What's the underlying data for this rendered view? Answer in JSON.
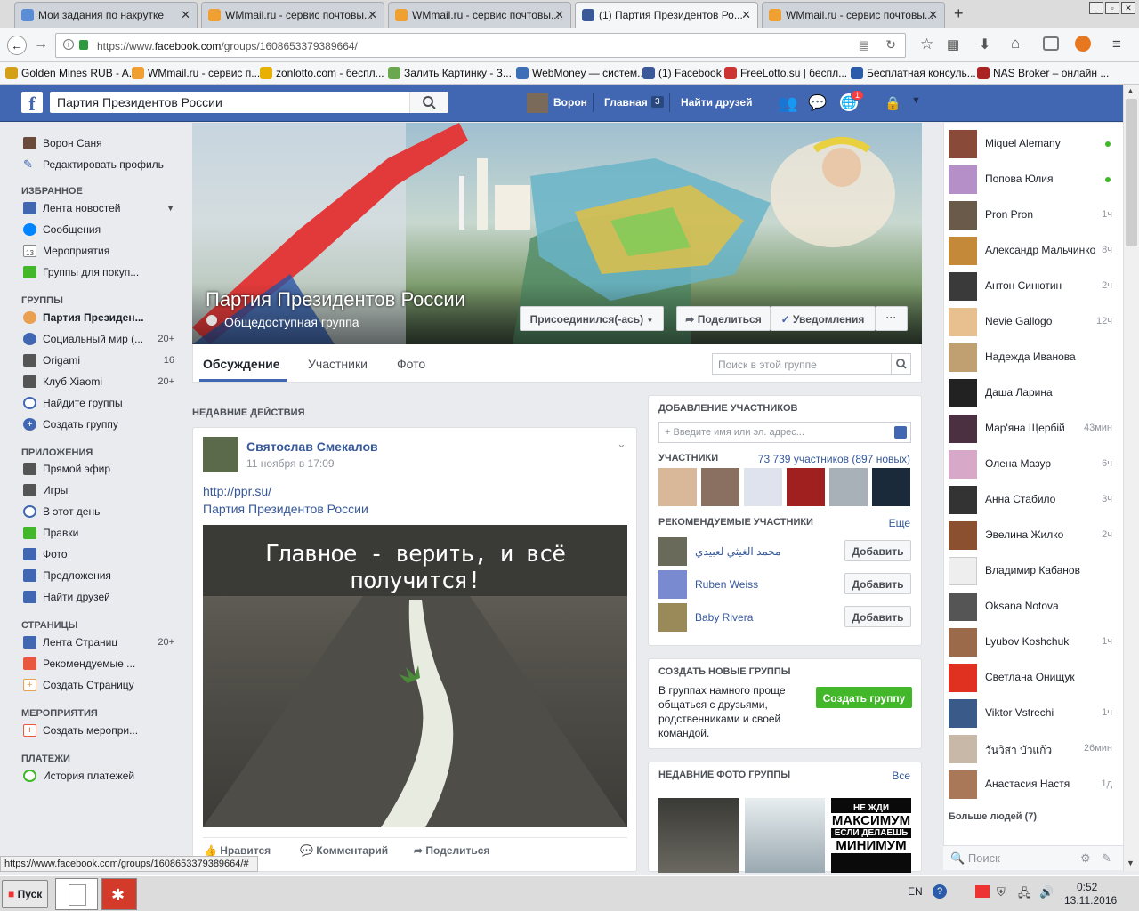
{
  "browser": {
    "tabs": [
      {
        "title": "Мои задания по накрутке",
        "color": "#5b8dd6"
      },
      {
        "title": "WMmail.ru - сервис почтовы...",
        "color": "#f0a030"
      },
      {
        "title": "WMmail.ru - сервис почтовы...",
        "color": "#f0a030"
      },
      {
        "title": "(1) Партия Президентов Ро...",
        "color": "#3b5998"
      },
      {
        "title": "WMmail.ru - сервис почтовы...",
        "color": "#f0a030"
      }
    ],
    "url_prefix": "https://www.",
    "url_host": "facebook.com",
    "url_path": "/groups/1608653379389664/",
    "bookmarks": [
      {
        "label": "Golden Mines RUB - A...",
        "color": "#d4a017"
      },
      {
        "label": "WMmail.ru - сервис п...",
        "color": "#f0a030"
      },
      {
        "label": "zonlotto.com - беспл...",
        "color": "#e8b000"
      },
      {
        "label": "Залить Картинку - З...",
        "color": "#6aa84f"
      },
      {
        "label": "WebMoney — систем...",
        "color": "#3d6fb6"
      },
      {
        "label": "(1) Facebook",
        "color": "#3b5998"
      },
      {
        "label": "FreeLotto.su | беспл...",
        "color": "#cc3333"
      },
      {
        "label": "Бесплатная консуль...",
        "color": "#2a5caa"
      },
      {
        "label": "NAS Broker – онлайн ...",
        "color": "#aa2222"
      }
    ],
    "status_url": "https://www.facebook.com/groups/1608653379389664/#"
  },
  "fb": {
    "search_value": "Партия Президентов России",
    "nav": {
      "profile_name": "Ворон",
      "home": "Главная",
      "home_count": "3",
      "find_friends": "Найти друзей",
      "notif_count": "1"
    }
  },
  "left": {
    "user": "Ворон Саня",
    "edit_profile": "Редактировать профиль",
    "fav_head": "Избранное",
    "fav": [
      {
        "label": "Лента новостей",
        "color": "#4267b2"
      },
      {
        "label": "Сообщения",
        "color": "#0084ff"
      },
      {
        "label": "Мероприятия",
        "color": "#e9573f",
        "badge": "13"
      },
      {
        "label": "Группы для покуп...",
        "color": "#42b72a"
      }
    ],
    "groups_head": "Группы",
    "groups": [
      {
        "label": "Партия Президен...",
        "color": "#e9a050",
        "bold": true
      },
      {
        "label": "Социальный мир (...",
        "color": "#4267b2",
        "count": "20+"
      },
      {
        "label": "Origami",
        "color": "#555",
        "count": "16"
      },
      {
        "label": "Клуб Xiaomi",
        "color": "#555",
        "count": "20+"
      },
      {
        "label": "Найдите группы",
        "color": "#4267b2"
      },
      {
        "label": "Создать группу",
        "color": "#4267b2"
      }
    ],
    "apps_head": "Приложения",
    "apps": [
      {
        "label": "Прямой эфир",
        "color": "#555"
      },
      {
        "label": "Игры",
        "color": "#555"
      },
      {
        "label": "В этот день",
        "color": "#4267b2"
      },
      {
        "label": "Правки",
        "color": "#42b72a"
      },
      {
        "label": "Фото",
        "color": "#4267b2"
      },
      {
        "label": "Предложения",
        "color": "#4267b2"
      },
      {
        "label": "Найти друзей",
        "color": "#4267b2"
      }
    ],
    "pages_head": "Страницы",
    "pages": [
      {
        "label": "Лента Страниц",
        "color": "#4267b2",
        "count": "20+"
      },
      {
        "label": "Рекомендуемые ...",
        "color": "#e9573f"
      },
      {
        "label": "Создать Страницу",
        "color": "#e9a050"
      }
    ],
    "events_head": "Мероприятия",
    "events": [
      {
        "label": "Создать меропри...",
        "color": "#e9573f"
      }
    ],
    "payments_head": "Платежи",
    "payments": [
      {
        "label": "История платежей",
        "color": "#42b72a"
      }
    ]
  },
  "group": {
    "name": "Партия Президентов России",
    "privacy": "Общедоступная группа",
    "joined_btn": "Присоединился(-ась)",
    "share_btn": "Поделиться",
    "notif_btn": "Уведомления",
    "more_btn": "···",
    "tabs": [
      "Обсуждение",
      "Участники",
      "Фото"
    ],
    "search_placeholder": "Поиск в этой группе"
  },
  "feed": {
    "recent_head": "Недавние действия",
    "post": {
      "author": "Святослав Смекалов",
      "time": "11 ноября в 17:09",
      "link": "http://ppr.su/",
      "link_title": "Партия Президентов России",
      "image_text": "Главное - верить, и всё получится!",
      "like": "Нравится",
      "comment": "Комментарий",
      "share": "Поделиться"
    }
  },
  "rightcol": {
    "add_head": "Добавление участников",
    "add_placeholder": "+ Введите имя или эл. адрес...",
    "members_label": "Участники",
    "members_count": "73 739 участников (897 новых)",
    "rec_head": "Рекомендуемые участники",
    "rec_more": "Еще",
    "rec": [
      {
        "name": "محمد الغيثي لعبيدي",
        "btn": "Добавить"
      },
      {
        "name": "Ruben Weiss",
        "btn": "Добавить"
      },
      {
        "name": "Baby Rivera",
        "btn": "Добавить"
      }
    ],
    "create_head": "Создать новые группы",
    "create_text": "В группах намного проще общаться с друзьями, родственниками и своей командой.",
    "create_btn": "Создать группу",
    "photos_head": "Недавние фото группы",
    "photos_all": "Все",
    "photo3_line1": "НЕ ЖДИ",
    "photo3_line2": "МАКСИМУМ",
    "photo3_line3": "ЕСЛИ ДЕЛАЕШЬ",
    "photo3_line4": "МИНИМУМ"
  },
  "chat": {
    "people": [
      {
        "name": "Miquel Alemany",
        "time": "",
        "online": true,
        "color": "#8a4a3a"
      },
      {
        "name": "Попова Юлия",
        "time": "",
        "online": true,
        "color": "#b58fc8"
      },
      {
        "name": "Pron Pron",
        "time": "1ч",
        "color": "#6a5a4a"
      },
      {
        "name": "Александр Мальчинко",
        "time": "8ч",
        "color": "#c48a3a"
      },
      {
        "name": "Антон Синютин",
        "time": "2ч",
        "color": "#3a3a3a"
      },
      {
        "name": "Nevie Gallogo",
        "time": "12ч",
        "color": "#e8c090"
      },
      {
        "name": "Надежда Иванова",
        "time": "",
        "color": "#c0a070"
      },
      {
        "name": "Даша Ларина",
        "time": "",
        "color": "#222"
      },
      {
        "name": "Мар'яна Щербій",
        "time": "43мин",
        "color": "#4a3040"
      },
      {
        "name": "Олена Мазур",
        "time": "6ч",
        "color": "#d8a8c8"
      },
      {
        "name": "Анна Стабило",
        "time": "3ч",
        "color": "#333"
      },
      {
        "name": "Эвелина Жилко",
        "time": "2ч",
        "color": "#8a5030"
      },
      {
        "name": "Владимир Кабанов",
        "time": "",
        "color": "#eee"
      },
      {
        "name": "Oksana Notova",
        "time": "",
        "color": "#555"
      },
      {
        "name": "Lyubov Koshchuk",
        "time": "1ч",
        "color": "#9a6a4a"
      },
      {
        "name": "Светлана Онищук",
        "time": "",
        "color": "#e03020"
      },
      {
        "name": "Viktor Vstrechi",
        "time": "1ч",
        "color": "#3a5a8a"
      },
      {
        "name": "วันวิสา บัวแก้ว",
        "time": "26мин",
        "color": "#c8b8a8"
      },
      {
        "name": "Анастасия Настя",
        "time": "1д",
        "color": "#a87858"
      }
    ],
    "more_head": "Больше людей (7)",
    "search_placeholder": "Поиск"
  },
  "taskbar": {
    "start": "Пуск",
    "lang": "EN",
    "time": "0:52",
    "date": "13.11.2016"
  }
}
